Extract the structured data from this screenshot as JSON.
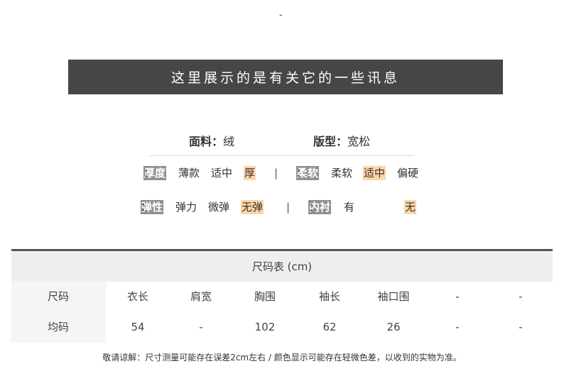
{
  "top_dash": "-",
  "banner": {
    "title": "这里展示的是有关它的一些讯息"
  },
  "info": {
    "fabric": {
      "label": "面料",
      "colon": "：",
      "value": "绒"
    },
    "fit": {
      "label": "版型",
      "colon": "：",
      "value": "宽松"
    }
  },
  "attributes": {
    "thickness": {
      "label": "厚度",
      "colon": "：",
      "options": [
        "薄款",
        "适中",
        "厚"
      ],
      "selected": "厚"
    },
    "softness": {
      "label": "柔软",
      "colon": "：",
      "options": [
        "柔软",
        "适中",
        "偏硬"
      ],
      "selected": "适中"
    },
    "elasticity": {
      "label": "弹性",
      "colon": "：",
      "options": [
        "弹力",
        "微弹",
        "无弹"
      ],
      "selected": "无弹"
    },
    "lining": {
      "label": "内衬",
      "colon": "：",
      "options": [
        "有",
        "无"
      ],
      "selected": "无"
    },
    "separator": "|"
  },
  "size_table": {
    "title": "尺码表 (cm)",
    "headers": [
      "尺码",
      "衣长",
      "肩宽",
      "胸围",
      "袖长",
      "袖口围",
      "-",
      "-"
    ],
    "rows": [
      [
        "均码",
        "54",
        "-",
        "102",
        "62",
        "26",
        "-",
        "-"
      ]
    ]
  },
  "note": "敬请谅解：尺寸测量可能存在误差2cm左右  /  颜色显示可能存在轻微色差，以收到的实物为准。",
  "colors": {
    "banner_bg": "#464646",
    "highlight": "#ffd5a8",
    "tag_bg": "#909090"
  }
}
